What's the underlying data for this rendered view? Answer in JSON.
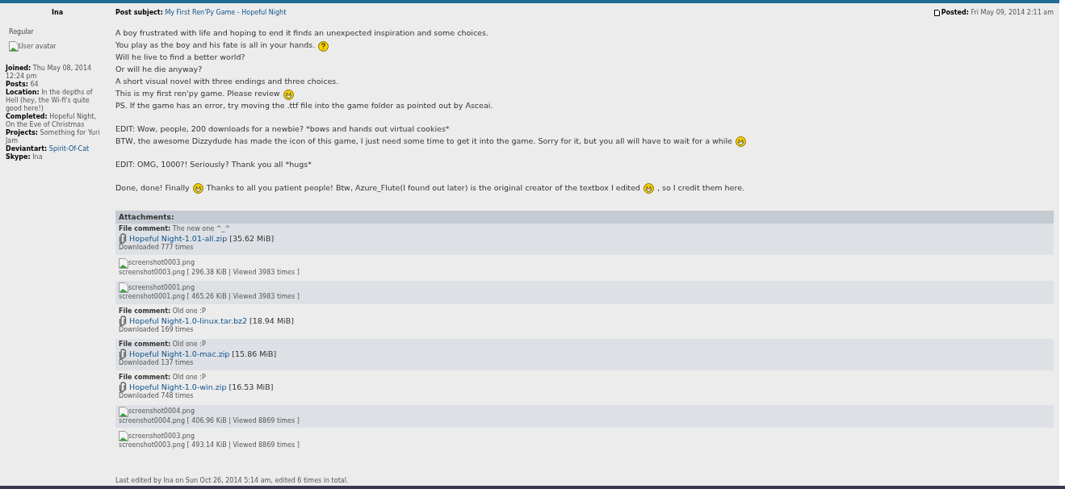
{
  "author": {
    "name": "Ina",
    "rank": "Regular",
    "avatar_alt": "User avatar",
    "fields": [
      {
        "label": "Joined:",
        "value": "Thu May 08, 2014 12:24 pm",
        "link": false
      },
      {
        "label": "Posts:",
        "value": "64",
        "link": false
      },
      {
        "label": "Location:",
        "value": "In the depths of Hell (hey, the Wi-fi's quite good here!)",
        "link": false
      },
      {
        "label": "Completed:",
        "value": "Hopeful Night, On the Eve of Christmas",
        "link": false
      },
      {
        "label": "Projects:",
        "value": "Something for Yuri Jam",
        "link": false
      },
      {
        "label": "Deviantart:",
        "value": "Spirit-Of-Cat",
        "link": true
      },
      {
        "label": "Skype:",
        "value": "Ina",
        "link": false
      }
    ]
  },
  "post": {
    "subject_label": "Post subject:",
    "subject": "My First Ren'Py Game - Hopeful Night",
    "posted_label": "Posted:",
    "posted": "Fri May 09, 2014 2:11 am",
    "paragraphs": [
      [
        [
          {
            "kind": "text",
            "text": "A boy frustrated with life and hoping to end it finds an unexpected inspiration and some choices."
          }
        ],
        [
          {
            "kind": "text",
            "text": "You play as the boy and his fate is all in your hands."
          },
          {
            "kind": "question"
          }
        ],
        [
          {
            "kind": "text",
            "text": "Will he live to find a better world?"
          }
        ],
        [
          {
            "kind": "text",
            "text": "Or will he die anyway?"
          }
        ],
        [
          {
            "kind": "text",
            "text": "A short visual novel with three endings and three choices."
          }
        ],
        [
          {
            "kind": "text",
            "text": "This is my first ren'py game. Please review"
          },
          {
            "kind": "grin"
          }
        ],
        [
          {
            "kind": "text",
            "text": "PS. If the game has an error, try moving the .ttf file into the game folder as pointed out by Asceai."
          }
        ]
      ],
      [
        [
          {
            "kind": "text",
            "text": "EDIT: Wow, people, 200 downloads for a newbie? *bows and hands out virtual cookies*"
          }
        ],
        [
          {
            "kind": "text",
            "text": "BTW, the awesome Dizzydude has made the icon of this game, I just need some time to get it into the game. Sorry for it, but you all will have to wait for a while"
          },
          {
            "kind": "grin"
          }
        ]
      ],
      [
        [
          {
            "kind": "text",
            "text": "EDIT: OMG, 1000?! Seriously? Thank you all *hugs*"
          }
        ]
      ],
      [
        [
          {
            "kind": "text",
            "text": "Done, done! Finally"
          },
          {
            "kind": "grin"
          },
          {
            "kind": "text",
            "text": "Thanks to all you patient people! Btw, Azure_Flute(I found out later) is the original creator of the textbox I edited"
          },
          {
            "kind": "grin"
          },
          {
            "kind": "text",
            "text": ", so I credit them here."
          }
        ]
      ]
    ],
    "attachments_title": "Attachments:",
    "attachments": [
      {
        "kind": "file",
        "comment_label": "File comment:",
        "comment": "The new one ^_^",
        "name": "Hopeful Night-1.01-all.zip",
        "size": "[35.62 MiB]",
        "downloads": "Downloaded 777 times"
      },
      {
        "kind": "image",
        "alt": "screenshot0003.png",
        "name": "screenshot0003.png",
        "info": "[ 296.38 KiB | Viewed 3983 times ]"
      },
      {
        "kind": "image",
        "alt": "screenshot0001.png",
        "name": "screenshot0001.png",
        "info": "[ 465.26 KiB | Viewed 3983 times ]"
      },
      {
        "kind": "file",
        "comment_label": "File comment:",
        "comment": "Old one :P",
        "name": "Hopeful Night-1.0-linux.tar.bz2",
        "size": "[18.94 MiB]",
        "downloads": "Downloaded 169 times"
      },
      {
        "kind": "file",
        "comment_label": "File comment:",
        "comment": "Old one :P",
        "name": "Hopeful Night-1.0-mac.zip",
        "size": "[15.86 MiB]",
        "downloads": "Downloaded 137 times"
      },
      {
        "kind": "file",
        "comment_label": "File comment:",
        "comment": "Old one :P",
        "name": "Hopeful Night-1.0-win.zip",
        "size": "[16.53 MiB]",
        "downloads": "Downloaded 748 times"
      },
      {
        "kind": "image",
        "alt": "screenshot0004.png",
        "name": "screenshot0004.png",
        "info": "[ 406.96 KiB | Viewed 8869 times ]"
      },
      {
        "kind": "image",
        "alt": "screenshot0003.png",
        "name": "screenshot0003.png",
        "info": "[ 493.14 KiB | Viewed 8869 times ]"
      }
    ],
    "edited": "Last edited by Ina on Sun Oct 26, 2014 5:14 am, edited 6 times in total."
  }
}
